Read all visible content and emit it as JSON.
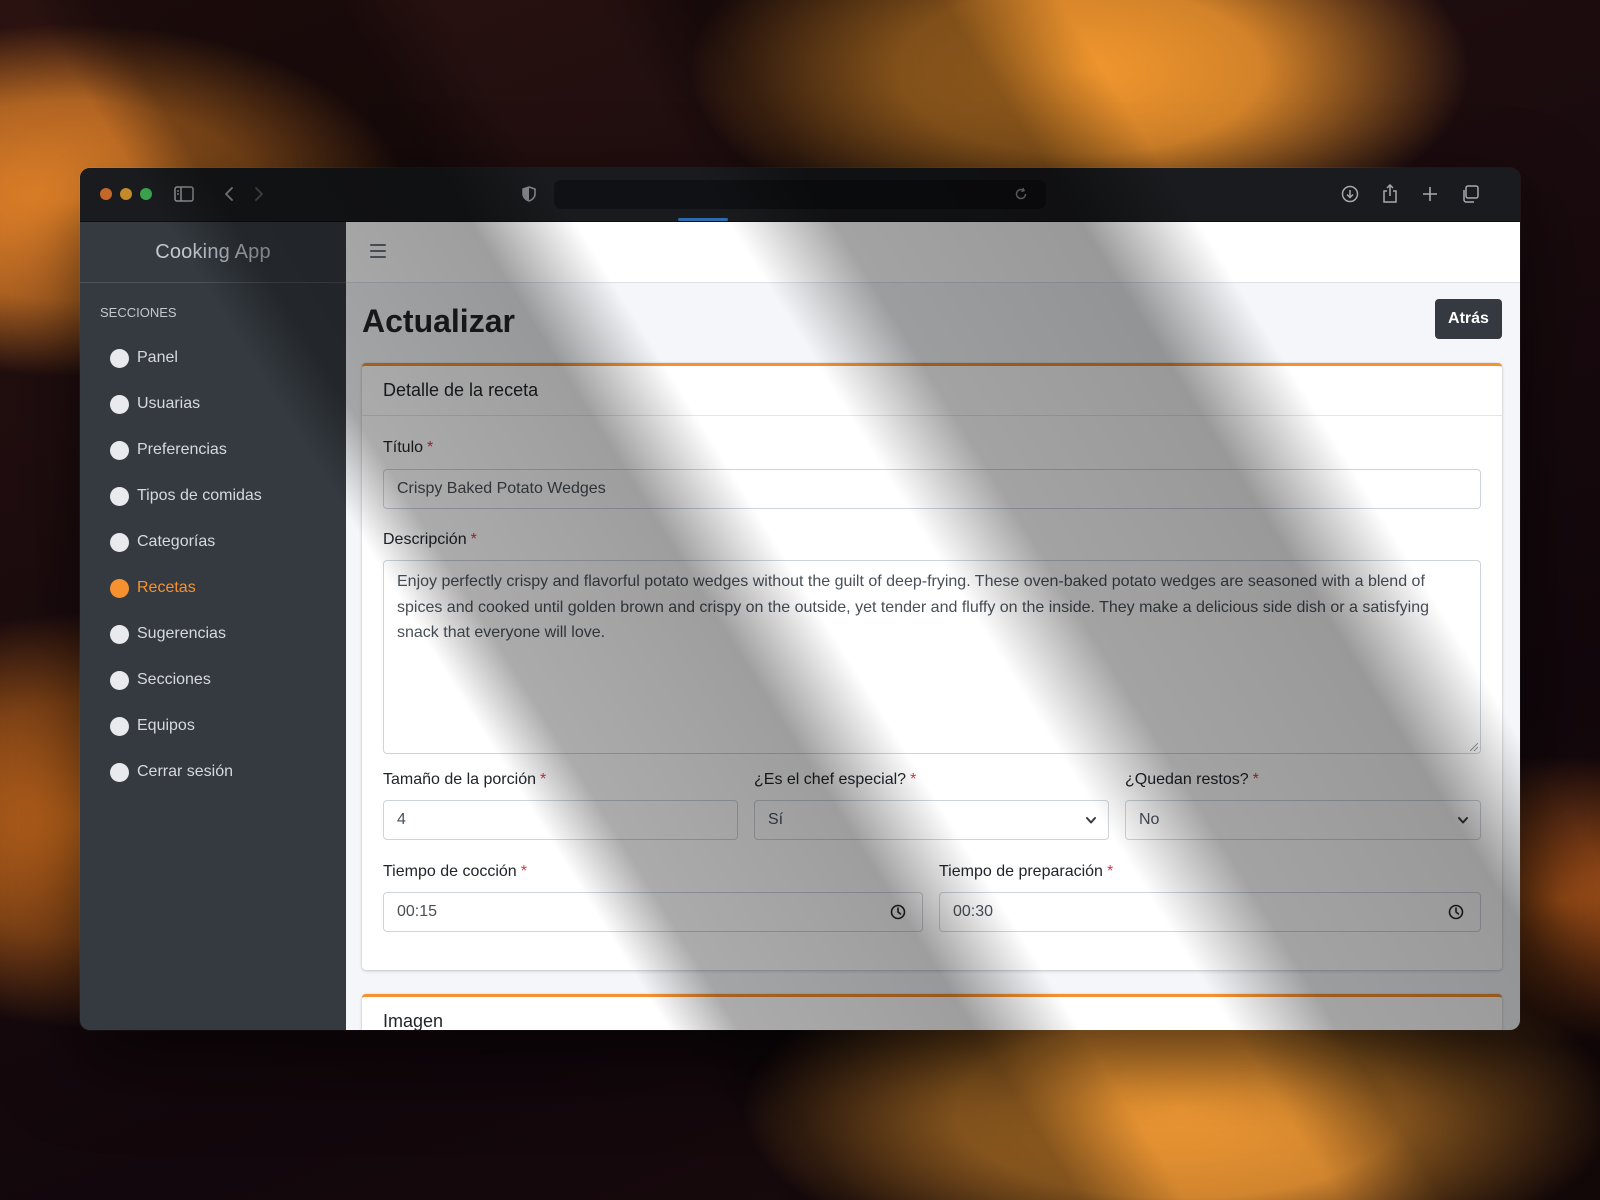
{
  "app": {
    "brand": "Cooking App",
    "accent_color": "#f7912f"
  },
  "sidebar": {
    "section_header": "SECCIONES",
    "items": [
      {
        "label": "Panel",
        "active": false
      },
      {
        "label": "Usuarias",
        "active": false
      },
      {
        "label": "Preferencias",
        "active": false
      },
      {
        "label": "Tipos de comidas",
        "active": false
      },
      {
        "label": "Categorías",
        "active": false
      },
      {
        "label": "Recetas",
        "active": true
      },
      {
        "label": "Sugerencias",
        "active": false
      },
      {
        "label": "Secciones",
        "active": false
      },
      {
        "label": "Equipos",
        "active": false
      },
      {
        "label": "Cerrar sesión",
        "active": false
      }
    ]
  },
  "page": {
    "title": "Actualizar",
    "back_label": "Atrás"
  },
  "recipe_card": {
    "header": "Detalle de la receta",
    "title_label": "Título",
    "title_value": "Crispy Baked Potato Wedges",
    "description_label": "Descripción",
    "description_value": "Enjoy perfectly crispy and flavorful potato wedges without the guilt of deep-frying. These oven-baked potato wedges are seasoned with a blend of spices and cooked until golden brown and crispy on the outside, yet tender and fluffy on the inside. They make a delicious side dish or a satisfying snack that everyone will love.",
    "portion_label": "Tamaño de la porción",
    "portion_value": "4",
    "chef_label": "¿Es el chef especial?",
    "chef_value": "Sí",
    "leftovers_label": "¿Quedan restos?",
    "leftovers_value": "No",
    "cook_time_label": "Tiempo de cocción",
    "cook_time_value": "00:15",
    "prep_time_label": "Tiempo de preparación",
    "prep_time_value": "00:30",
    "required_mark": "*"
  },
  "image_card": {
    "header": "Imagen"
  },
  "icons": [
    "sidebar-toggle-icon",
    "back-arrow-icon",
    "forward-arrow-icon",
    "shield-icon",
    "reload-icon",
    "download-icon",
    "share-icon",
    "plus-icon",
    "tabs-icon",
    "hamburger-icon",
    "chevron-down-icon",
    "clock-icon"
  ]
}
